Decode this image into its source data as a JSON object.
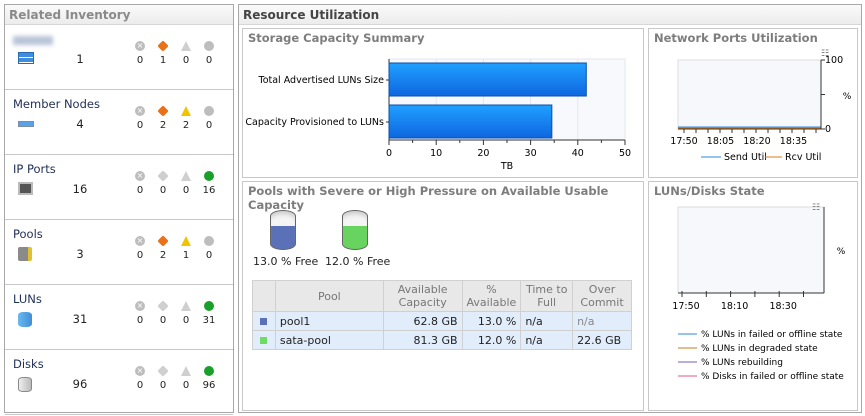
{
  "left_panel": {
    "title": "Related Inventory",
    "items": [
      {
        "name": "",
        "icon": "server-icon",
        "count": "1",
        "critical": "0",
        "major": "1",
        "warning": "0",
        "normal": "0",
        "normal_color": "gray"
      },
      {
        "name": "Member Nodes",
        "icon": "node-icon",
        "count": "4",
        "critical": "0",
        "major": "2",
        "warning": "2",
        "normal": "0",
        "normal_color": "gray"
      },
      {
        "name": "IP Ports",
        "icon": "port-icon",
        "count": "16",
        "critical": "0",
        "major": "0",
        "warning": "0",
        "normal": "16",
        "normal_color": "green"
      },
      {
        "name": "Pools",
        "icon": "pool-icon",
        "count": "3",
        "critical": "0",
        "major": "2",
        "warning": "1",
        "normal": "0",
        "normal_color": "gray"
      },
      {
        "name": "LUNs",
        "icon": "lun-icon",
        "count": "31",
        "critical": "0",
        "major": "0",
        "warning": "0",
        "normal": "31",
        "normal_color": "green"
      },
      {
        "name": "Disks",
        "icon": "disk-icon",
        "count": "96",
        "critical": "0",
        "major": "0",
        "warning": "0",
        "normal": "96",
        "normal_color": "green"
      }
    ]
  },
  "right_panel": {
    "title": "Resource Utilization"
  },
  "storage": {
    "title": "Storage Capacity Summary"
  },
  "network": {
    "title": "Network Ports Utilization"
  },
  "pools": {
    "title": "Pools with Severe or High Pressure on Available Usable Capacity",
    "gauges": [
      {
        "label": "13.0 % Free",
        "color": "#5a71b8",
        "free": 13.0
      },
      {
        "label": "12.0 % Free",
        "color": "#66d45e",
        "free": 12.0
      }
    ],
    "columns": [
      "",
      "Pool",
      "Available Capacity",
      "% Available",
      "Time to Full",
      "Over Commit"
    ],
    "rows": [
      {
        "color": "#5a71b8",
        "pool": "pool1",
        "available": "62.8 GB",
        "pct": "13.0 %",
        "ttf": "n/a",
        "over": "n/a"
      },
      {
        "color": "#6cdc62",
        "pool": "sata-pool",
        "available": "81.3 GB",
        "pct": "12.0 %",
        "ttf": "n/a",
        "over": "22.6 GB"
      }
    ]
  },
  "luns": {
    "title": "LUNs/Disks State"
  },
  "chart_data": [
    {
      "type": "bar",
      "orientation": "horizontal",
      "title": "Storage Capacity Summary",
      "categories": [
        "Total Advertised LUNs Size",
        "Capacity Provisioned to LUNs"
      ],
      "values": [
        41.8,
        34.5
      ],
      "xlabel": "TB",
      "xlim": [
        0,
        50
      ],
      "xticks": [
        "0",
        "10",
        "20",
        "30",
        "40",
        "50"
      ],
      "color": "#1a7ff0",
      "grid": true
    },
    {
      "type": "line",
      "title": "Network Ports Utilization",
      "xticks": [
        "17:50",
        "18:05",
        "18:20",
        "18:35"
      ],
      "ylabel": "%",
      "yticks": [
        "0",
        "100"
      ],
      "ylim": [
        0,
        100
      ],
      "legend": "bottom",
      "series": [
        {
          "name": "Send Util",
          "color": "#2e8ae6",
          "values": [
            1,
            1,
            1,
            1
          ]
        },
        {
          "name": "Rcv Util",
          "color": "#e07b12",
          "values": [
            0,
            0,
            0,
            0
          ]
        }
      ]
    },
    {
      "type": "line",
      "title": "LUNs/Disks State",
      "xticks": [
        "17:50",
        "18:10",
        "18:30"
      ],
      "ylabel": "%",
      "legend": "bottom",
      "series": [
        {
          "name": "% LUNs in failed or offline state",
          "color": "#2e8ae6"
        },
        {
          "name": "% LUNs in degraded state",
          "color": "#c87a22"
        },
        {
          "name": "% LUNs rebuilding",
          "color": "#7a5cbf"
        },
        {
          "name": "% Disks in failed or offline state",
          "color": "#e0568c"
        }
      ]
    }
  ]
}
